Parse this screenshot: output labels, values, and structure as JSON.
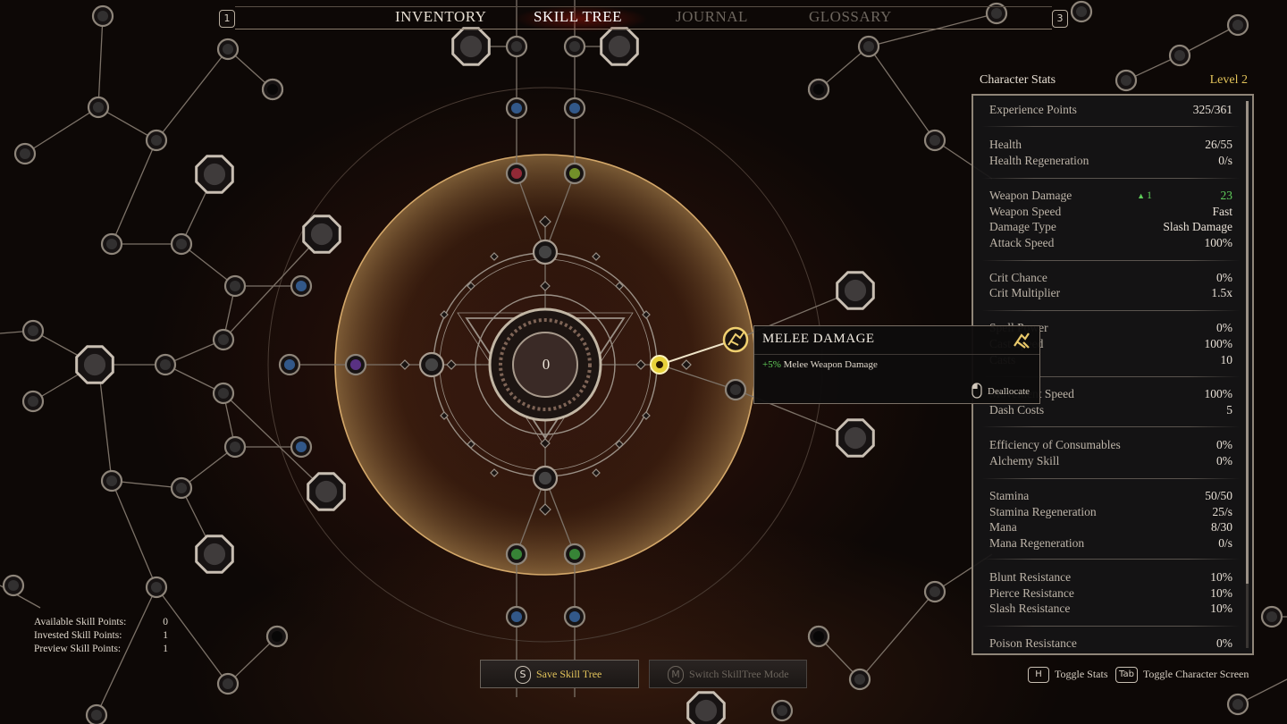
{
  "nav": {
    "left_key": "1",
    "right_key": "3",
    "tabs": [
      {
        "label": "INVENTORY",
        "state": "normal"
      },
      {
        "label": "SKILL TREE",
        "state": "active"
      },
      {
        "label": "JOURNAL",
        "state": "disabled"
      },
      {
        "label": "GLOSSARY",
        "state": "disabled"
      }
    ]
  },
  "tree": {
    "center_value": "0",
    "selected_node": "melee-damage",
    "colors": {
      "ring": "#c8a46a",
      "selected": "#e8d23a",
      "line": "#8a7e72"
    }
  },
  "tooltip": {
    "title": "MELEE DAMAGE",
    "bonus": "+5%",
    "description": "Melee Weapon Damage",
    "action": "Deallocate",
    "icon": "melee-damage-icon"
  },
  "stats": {
    "title": "Character Stats",
    "level": "Level 2",
    "rows": [
      {
        "label": "Experience Points",
        "value": "325/361"
      },
      {
        "label": "Health",
        "value": "26/55"
      },
      {
        "label": "Health Regeneration",
        "value": "0/s"
      },
      {
        "label": "Weapon Damage",
        "value": "23",
        "delta": "1"
      },
      {
        "label": "Weapon Speed",
        "value": "Fast"
      },
      {
        "label": "Damage Type",
        "value": "Slash Damage"
      },
      {
        "label": "Attack Speed",
        "value": "100%"
      },
      {
        "label": "Crit Chance",
        "value": "0%"
      },
      {
        "label": "Crit Multiplier",
        "value": "1.5x"
      },
      {
        "label": "Spell Power",
        "value": "0%"
      },
      {
        "label": "Cast Speed",
        "value": "100%"
      },
      {
        "label": "Casts",
        "value": "10"
      },
      {
        "label": "Movement Speed",
        "value": "100%"
      },
      {
        "label": "Dash Costs",
        "value": "5"
      },
      {
        "label": "Efficiency of Consumables",
        "value": "0%"
      },
      {
        "label": "Alchemy Skill",
        "value": "0%"
      },
      {
        "label": "Stamina",
        "value": "50/50"
      },
      {
        "label": "Stamina Regeneration",
        "value": "25/s"
      },
      {
        "label": "Mana",
        "value": "8/30"
      },
      {
        "label": "Mana Regeneration",
        "value": "0/s"
      },
      {
        "label": "Blunt  Resistance",
        "value": "10%"
      },
      {
        "label": "Pierce Resistance",
        "value": "10%"
      },
      {
        "label": "Slash Resistance",
        "value": "10%"
      },
      {
        "label": "Poison Resistance",
        "value": "0%"
      }
    ]
  },
  "points": {
    "available_label": "Available Skill Points:",
    "available": "0",
    "invested_label": "Invested Skill Points:",
    "invested": "1",
    "preview_label": "Preview Skill Points:",
    "preview": "1"
  },
  "buttons": {
    "save_key": "S",
    "save_label": "Save Skill Tree",
    "switch_key": "M",
    "switch_label": "Switch SkillTree Mode"
  },
  "hints": {
    "stats_key": "H",
    "stats_label": "Toggle Stats",
    "char_key": "Tab",
    "char_label": "Toggle Character Screen"
  }
}
